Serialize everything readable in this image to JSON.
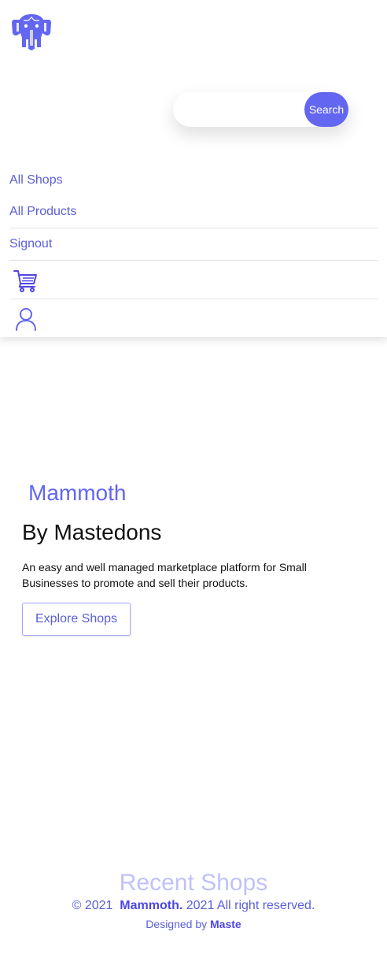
{
  "header": {
    "logo_icon": "elephant-logo-icon",
    "search": {
      "placeholder": "",
      "value": "",
      "button_label": "Search"
    },
    "nav": {
      "all_shops": "All Shops",
      "all_products": "All Products",
      "signout": "Signout",
      "cart_icon": "cart-icon",
      "user_icon": "user-icon"
    }
  },
  "hero": {
    "brand": "Mammoth",
    "tagline": "By Mastedons",
    "description": "An easy and well managed marketplace platform for Small Businesses to promote and sell their products.",
    "cta_label": "Explore Shops"
  },
  "recent_shops": {
    "heading": "Recent Shops"
  },
  "footer": {
    "copyright_prefix": "© 2021",
    "brand": "Mammoth.",
    "copyright_suffix": "2021 All right reserved.",
    "designed_by_prefix": "Designed by",
    "designer": "Maste"
  },
  "colors": {
    "accent": "#6366f1",
    "link": "#5b5fd6"
  }
}
